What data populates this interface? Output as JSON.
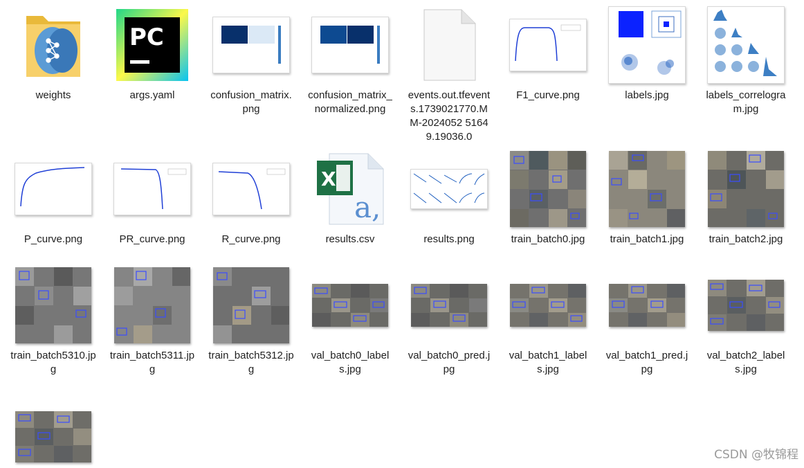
{
  "files": [
    {
      "name": "weights",
      "icon": "folder-icon"
    },
    {
      "name": "args.yaml",
      "icon": "pycharm-icon"
    },
    {
      "name": "confusion_matrix.png",
      "icon": "image-thumbnail"
    },
    {
      "name": "confusion_matrix_normalized.png",
      "icon": "image-thumbnail"
    },
    {
      "name": "events.out.tfevents.1739021770.MM-2024052 51649.19036.0",
      "icon": "blank-file-icon"
    },
    {
      "name": "F1_curve.png",
      "icon": "image-thumbnail"
    },
    {
      "name": "labels.jpg",
      "icon": "image-thumbnail"
    },
    {
      "name": "labels_correlogram.jpg",
      "icon": "image-thumbnail"
    },
    {
      "name": "P_curve.png",
      "icon": "image-thumbnail"
    },
    {
      "name": "PR_curve.png",
      "icon": "image-thumbnail"
    },
    {
      "name": "R_curve.png",
      "icon": "image-thumbnail"
    },
    {
      "name": "results.csv",
      "icon": "excel-csv-icon"
    },
    {
      "name": "results.png",
      "icon": "image-thumbnail"
    },
    {
      "name": "train_batch0.jpg",
      "icon": "image-thumbnail"
    },
    {
      "name": "train_batch1.jpg",
      "icon": "image-thumbnail"
    },
    {
      "name": "train_batch2.jpg",
      "icon": "image-thumbnail"
    },
    {
      "name": "train_batch5310.jpg",
      "icon": "image-thumbnail"
    },
    {
      "name": "train_batch5311.jpg",
      "icon": "image-thumbnail"
    },
    {
      "name": "train_batch5312.jpg",
      "icon": "image-thumbnail"
    },
    {
      "name": "val_batch0_labels.jpg",
      "icon": "image-thumbnail"
    },
    {
      "name": "val_batch0_pred.jpg",
      "icon": "image-thumbnail"
    },
    {
      "name": "val_batch1_labels.jpg",
      "icon": "image-thumbnail"
    },
    {
      "name": "val_batch1_pred.jpg",
      "icon": "image-thumbnail"
    },
    {
      "name": "val_batch2_labels.jpg",
      "icon": "image-thumbnail"
    },
    {
      "name": "",
      "icon": "image-thumbnail"
    }
  ],
  "watermark": "CSDN @牧锦程",
  "colors": {
    "folder": "#f5c542",
    "excel": "#1e7145",
    "matrix": "#08306b",
    "curve": "#1f3fd6"
  }
}
